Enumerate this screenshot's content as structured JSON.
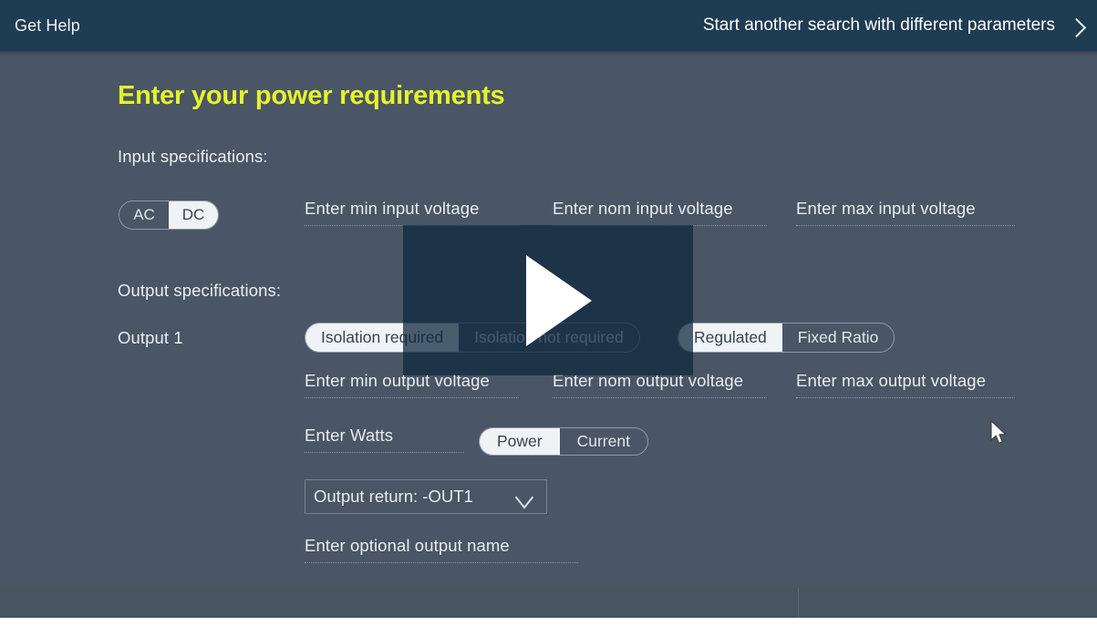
{
  "topbar": {
    "help_label": "Get Help",
    "restart_label": "Start another search with different parameters",
    "chevron_icon": "chevron-right-icon"
  },
  "page": {
    "title": "Enter your power requirements",
    "title_color": "#e5f32b",
    "background_color": "#4a5565",
    "topbar_color": "#1e3c52"
  },
  "input_section": {
    "label": "Input specifications:",
    "ac_dc_toggle": {
      "options": [
        "AC",
        "DC"
      ],
      "selected": "DC"
    },
    "fields": [
      {
        "placeholder": "Enter min input voltage",
        "value": ""
      },
      {
        "placeholder": "Enter nom input voltage",
        "value": ""
      },
      {
        "placeholder": "Enter max input voltage",
        "value": ""
      }
    ]
  },
  "output_section": {
    "label": "Output specifications:",
    "output_row_label": "Output  1",
    "isolation_toggle": {
      "options": [
        "Isolation required",
        "Isolation not required"
      ],
      "selected": "Isolation required"
    },
    "regulation_toggle": {
      "options": [
        "Regulated",
        "Fixed Ratio"
      ],
      "selected": "Regulated"
    },
    "voltage_fields": [
      {
        "placeholder": "Enter min output voltage",
        "value": ""
      },
      {
        "placeholder": "Enter nom output voltage",
        "value": ""
      },
      {
        "placeholder": "Enter max output voltage",
        "value": ""
      }
    ],
    "watts_field": {
      "placeholder": "Enter Watts",
      "value": ""
    },
    "power_current_toggle": {
      "options": [
        "Power",
        "Current"
      ],
      "selected": "Power"
    },
    "output_return_dropdown": {
      "selected": "Output return: -OUT1",
      "chevron_icon": "chevron-down-icon"
    },
    "optional_name_field": {
      "placeholder": "Enter optional output name",
      "value": ""
    }
  },
  "video_overlay": {
    "play_icon": "play-triangle-icon",
    "overlay_color": "#0e283e"
  },
  "cursor": {
    "icon": "mouse-pointer-icon"
  }
}
